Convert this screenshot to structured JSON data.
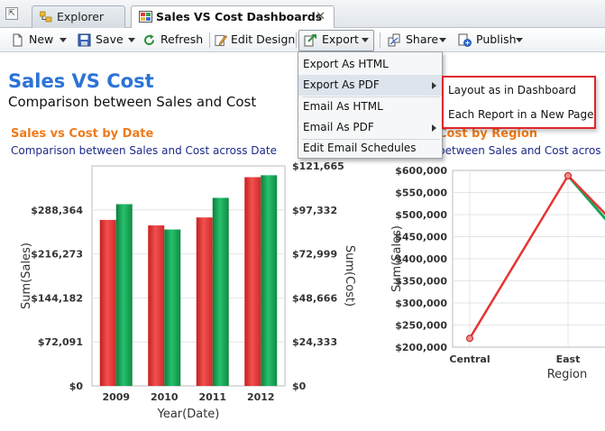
{
  "tabs": [
    {
      "label": "Explorer",
      "icon": "explorer-icon",
      "active": false
    },
    {
      "label": "Sales VS Cost Dashboards",
      "icon": "dashboard-icon",
      "active": true,
      "close": "✕"
    }
  ],
  "toolbar": {
    "new": "New",
    "save": "Save",
    "refresh": "Refresh",
    "edit_design": "Edit Design",
    "export": "Export",
    "share": "Share",
    "publish": "Publish"
  },
  "dashboard": {
    "title": "Sales VS Cost",
    "subtitle": "Comparison between Sales and Cost"
  },
  "export_menu": {
    "items": [
      {
        "label": "Export As HTML",
        "submenu": false
      },
      {
        "label": "Export As PDF",
        "submenu": true
      },
      {
        "label": "Email As HTML",
        "submenu": false
      },
      {
        "label": "Email As PDF",
        "submenu": true
      },
      {
        "label": "Edit Email Schedules",
        "submenu": false
      }
    ]
  },
  "pdf_submenu": {
    "items": [
      {
        "label": "Layout as in Dashboard"
      },
      {
        "label": "Each Report in a New Page"
      }
    ],
    "highlight_color": "#e0252b"
  },
  "colors": {
    "accent_title": "#2b73d6",
    "chart_title": "#ef7a1a",
    "chart_subtitle": "#1b2a8a",
    "sales": "#e63535",
    "cost": "#16a35a"
  },
  "chart_data": [
    {
      "type": "bar",
      "title": "Sales vs Cost by Date",
      "subtitle": "Comparison between Sales and Cost across Date",
      "xlabel": "Year(Date)",
      "ylabel": "Sum(Sales)",
      "y2label": "Sum(Cost)",
      "categories": [
        "2009",
        "2010",
        "2011",
        "2012"
      ],
      "series": [
        {
          "name": "Sum(Sales)",
          "axis": "left",
          "values": [
            272000,
            263000,
            276000,
            342000
          ]
        },
        {
          "name": "Sum(Cost)",
          "axis": "right",
          "values": [
            100500,
            86500,
            104000,
            116500
          ]
        }
      ],
      "left_ticks": [
        "$0",
        "$72,091",
        "$144,182",
        "$216,273",
        "$288,364"
      ],
      "left_tick_values": [
        0,
        72091,
        144182,
        216273,
        288364
      ],
      "right_ticks": [
        "$0",
        "$24,333",
        "$48,666",
        "$72,999",
        "$97,332",
        "$121,665"
      ],
      "right_tick_values": [
        0,
        24333,
        48666,
        72999,
        97332,
        121665
      ],
      "ylim": [
        0,
        360455
      ],
      "y2lim": [
        0,
        121665
      ],
      "grid": true
    },
    {
      "type": "line",
      "title": "Cost by Region",
      "subtitle": "between Sales and Cost acros",
      "xlabel": "Region",
      "ylabel": "Sum(Sales)",
      "categories": [
        "Central",
        "East"
      ],
      "series": [
        {
          "name": "Sum(Sales)",
          "values": [
            220000,
            588000
          ]
        }
      ],
      "y_ticks": [
        "$200,000",
        "$250,000",
        "$300,000",
        "$350,000",
        "$400,000",
        "$450,000",
        "$500,000",
        "$550,000",
        "$600,000"
      ],
      "y_tick_values": [
        200000,
        250000,
        300000,
        350000,
        400000,
        450000,
        500000,
        550000,
        600000
      ],
      "ylim": [
        200000,
        600000
      ],
      "grid": true
    }
  ]
}
